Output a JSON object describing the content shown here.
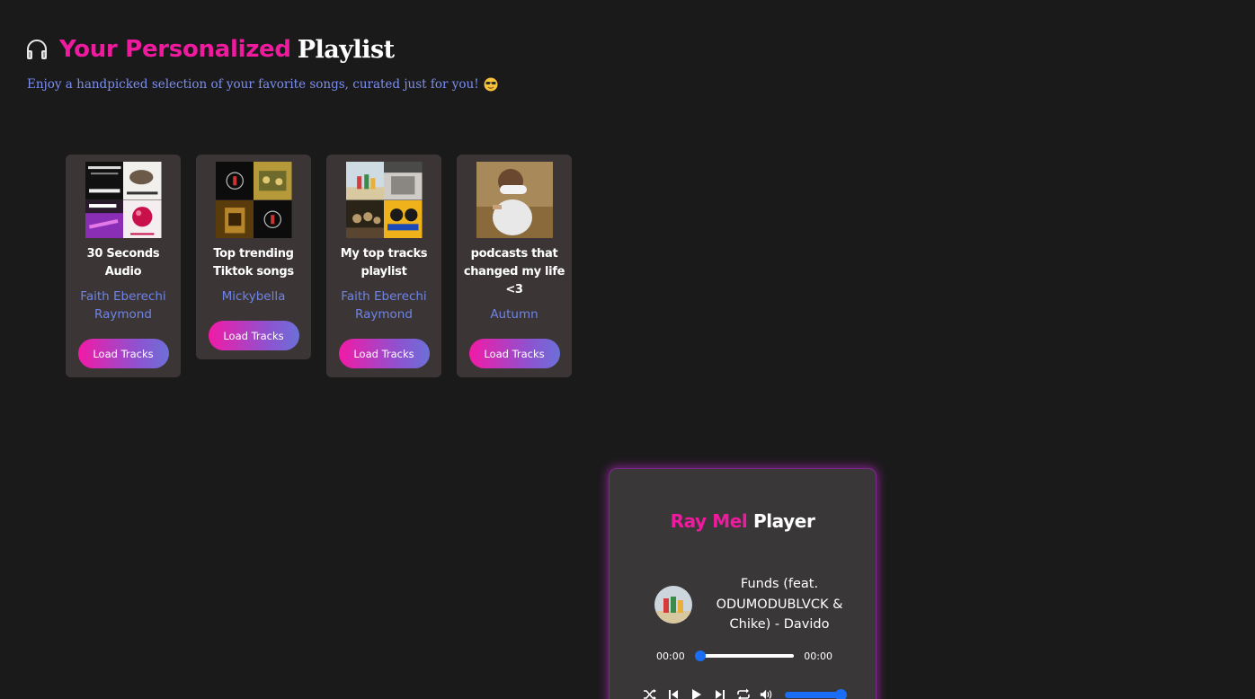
{
  "header": {
    "title_pink": "Your Personalized",
    "title_white": "Playlist",
    "subtitle": "Enjoy a handpicked selection of your favorite songs, curated just for you!",
    "icon": "headphones-icon",
    "emoji": "sunglasses-emoji"
  },
  "playlists": [
    {
      "title": "30 Seconds Audio",
      "owner": "Faith Eberechi Raymond",
      "button": "Load Tracks"
    },
    {
      "title": "Top trending Tiktok songs",
      "owner": "Mickybella",
      "button": "Load Tracks"
    },
    {
      "title": "My top tracks playlist",
      "owner": "Faith Eberechi Raymond",
      "button": "Load Tracks"
    },
    {
      "title": "podcasts that changed my life <3",
      "owner": "Autumn",
      "button": "Load Tracks"
    }
  ],
  "player": {
    "title_pink": "Ray Mel",
    "title_white": "Player",
    "track": "Funds (feat. ODUMODUBLVCK & Chike) - Davido",
    "current_time": "00:00",
    "duration": "00:00",
    "seek_progress": 0,
    "volume": 1.0,
    "controls": [
      "shuffle-icon",
      "previous-icon",
      "play-icon",
      "next-icon",
      "repeat-icon",
      "volume-icon"
    ]
  },
  "colors": {
    "background": "#1b1a1b",
    "accent_pink": "#ef1a9e",
    "accent_blue": "#6e84e6",
    "card": "#3c3536",
    "slider": "#1a6ef5"
  }
}
